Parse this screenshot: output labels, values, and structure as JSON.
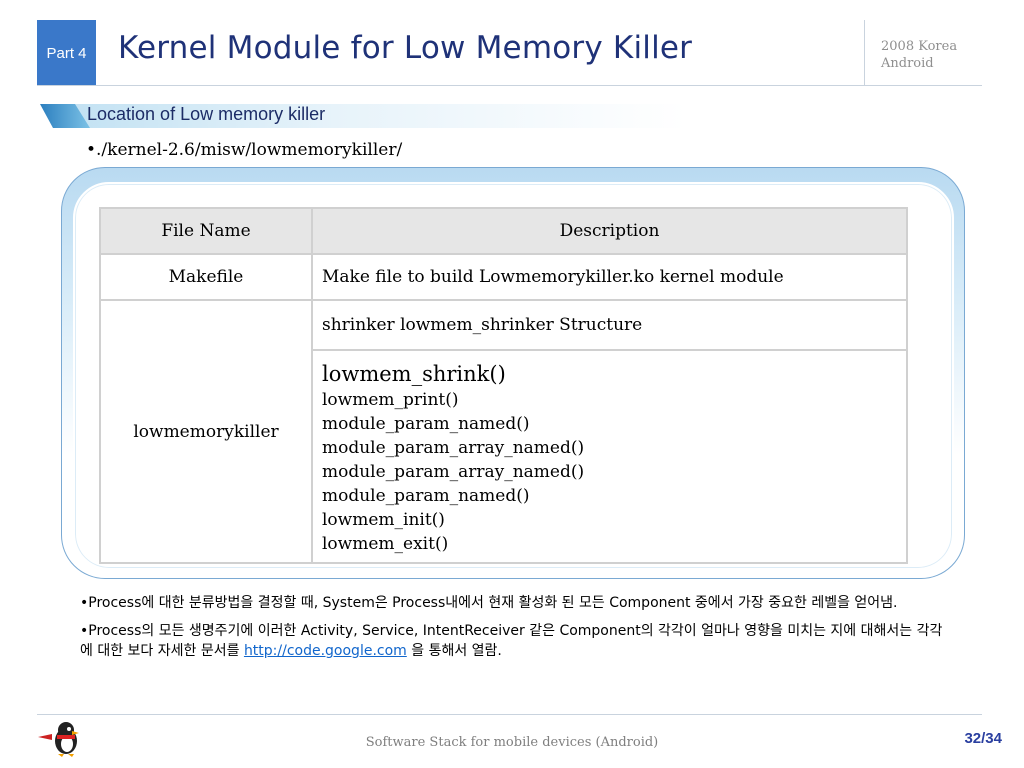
{
  "header": {
    "part_label": "Part 4",
    "title": "Kernel Module for Low Memory Killer",
    "year_line1": "2008 Korea",
    "year_line2": "Android"
  },
  "section": {
    "heading": "Location of Low memory killer",
    "path": "•./kernel-2.6/misw/lowmemorykiller/"
  },
  "table": {
    "col1_header": "File Name",
    "col2_header": "Description",
    "row1_name": "Makefile",
    "row1_desc": "Make file to build Lowmemorykiller.ko kernel module",
    "row2_name": "lowmemorykiller",
    "row2_desc_a": "shrinker lowmem_shrinker Structure",
    "row2_funcs": [
      "lowmem_shrink()",
      "lowmem_print()",
      "module_param_named()",
      "module_param_array_named()",
      "module_param_array_named()",
      "module_param_named()",
      "lowmem_init()",
      "lowmem_exit()"
    ]
  },
  "bullets": {
    "b1": "•Process에 대한 분류방법을 결정할 때, System은 Process내에서 현재 활성화 된 모든 Component 중에서 가장 중요한 레벨을 얻어냄.",
    "b2_before": "•Process의 모든 생명주기에 이러한 Activity, Service, IntentReceiver 같은 Component의 각각이 얼마나 영향을 미치는 지에 대해서는 각각에 대한 보다 자세한 문서를 ",
    "b2_link": "http://code.google.com",
    "b2_after": " 을 통해서 열람."
  },
  "footer": {
    "text": "Software Stack for mobile devices (Android)",
    "page": "32/34",
    "mascot_icon": "penguin-mascot-icon"
  },
  "colors": {
    "accent_blue": "#3a78c9",
    "title_navy": "#1f3278",
    "link": "#1166cc",
    "page_number": "#2a3fa0"
  }
}
